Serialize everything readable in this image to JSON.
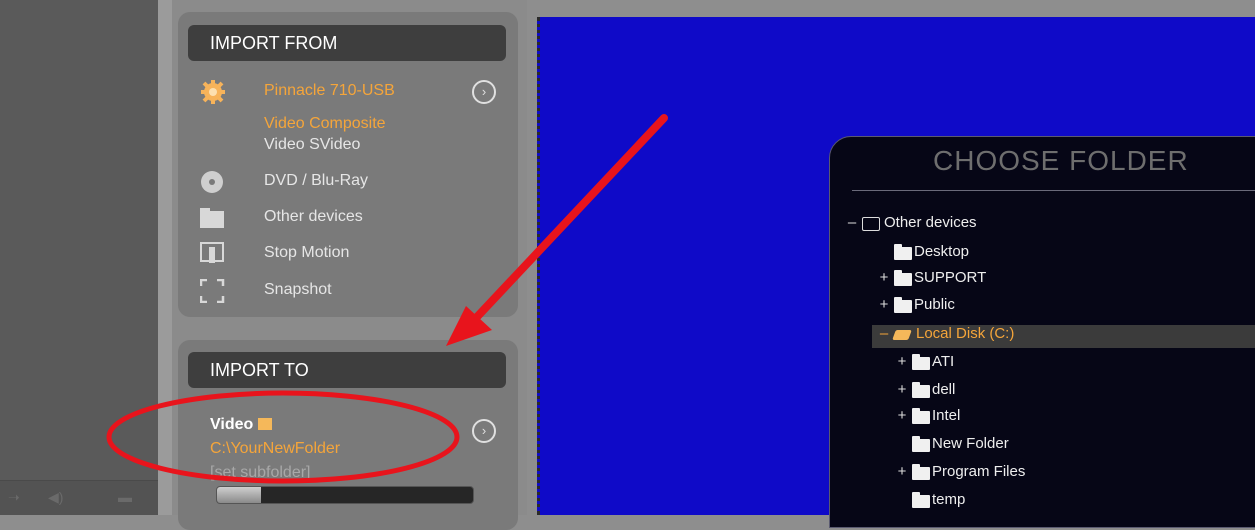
{
  "import_from": {
    "header": "IMPORT FROM",
    "device": "Pinnacle 710-USB",
    "inputs": [
      "Video Composite",
      "Video SVideo"
    ],
    "items": [
      {
        "label": "DVD / Blu-Ray",
        "icon": "disc-icon"
      },
      {
        "label": "Other devices",
        "icon": "folder-icon"
      },
      {
        "label": "Stop Motion",
        "icon": "stop-motion-icon"
      },
      {
        "label": "Snapshot",
        "icon": "snapshot-icon"
      }
    ]
  },
  "import_to": {
    "header": "IMPORT TO",
    "type_label": "Video",
    "path": "C:\\YourNewFolder",
    "subfolder": "[set subfolder]",
    "progress": 0.17
  },
  "dialog": {
    "title": "CHOOSE FOLDER",
    "tree": [
      {
        "label": "Other devices",
        "expander": "–"
      },
      {
        "label": "Desktop",
        "expander": ""
      },
      {
        "label": "SUPPORT",
        "expander": "+"
      },
      {
        "label": "Public",
        "expander": "+"
      },
      {
        "label": "Local Disk (C:)",
        "expander": "–"
      },
      {
        "label": "ATI",
        "expander": "+"
      },
      {
        "label": "dell",
        "expander": "+"
      },
      {
        "label": "Intel",
        "expander": "+"
      },
      {
        "label": "New Folder",
        "expander": ""
      },
      {
        "label": "Program Files",
        "expander": "+"
      },
      {
        "label": "temp",
        "expander": ""
      }
    ]
  },
  "colors": {
    "accent": "#f5a53a",
    "annotation": "#e8141c",
    "preview": "#0f0ac8"
  }
}
